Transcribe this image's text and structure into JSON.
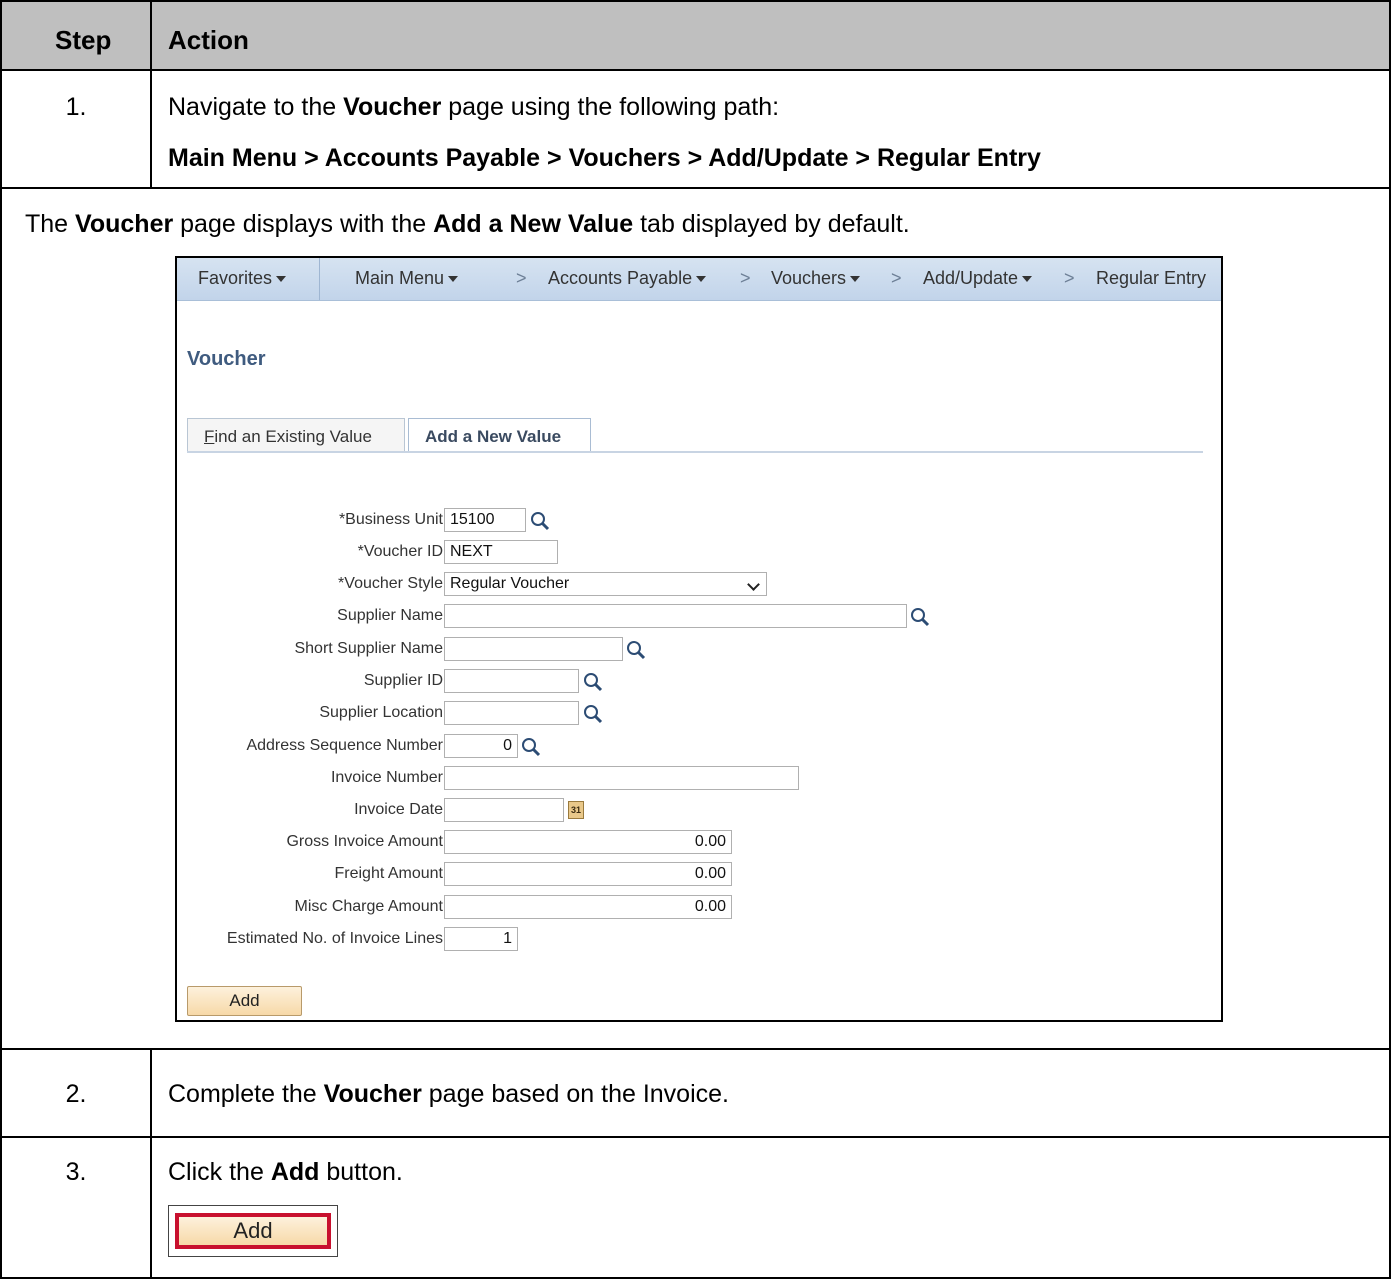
{
  "table": {
    "header": {
      "step": "Step",
      "action": "Action"
    },
    "step1": {
      "number": "1.",
      "text_pre": "Navigate to the ",
      "text_bold": "Voucher",
      "text_post": " page using the following path:",
      "path": "Main Menu > Accounts Payable > Vouchers > Add/Update > Regular Entry"
    },
    "note": {
      "pre": "The ",
      "b1": "Voucher",
      "mid": " page displays with the ",
      "b2": "Add a New Value",
      "post": " tab displayed by default."
    },
    "step2": {
      "number": "2.",
      "pre": "Complete the ",
      "bold": "Voucher",
      "post": " page based on the Invoice."
    },
    "step3": {
      "number": "3.",
      "pre": "Click the ",
      "bold": "Add",
      "post": " button.",
      "button_label": "Add"
    }
  },
  "screenshot": {
    "nav": {
      "favorites": "Favorites",
      "main_menu": "Main Menu",
      "accounts_payable": "Accounts Payable",
      "vouchers": "Vouchers",
      "add_update": "Add/Update",
      "regular_entry": "Regular Entry",
      "chevron": ">"
    },
    "page_title": "Voucher",
    "tabs": {
      "find_existing": "Find an Existing Value",
      "add_new": "Add a New Value"
    },
    "labels": {
      "business_unit": "*Business Unit",
      "voucher_id": "*Voucher ID",
      "voucher_style": "*Voucher Style",
      "supplier_name": "Supplier Name",
      "short_supplier_name": "Short Supplier Name",
      "supplier_id": "Supplier ID",
      "supplier_location": "Supplier Location",
      "address_sequence": "Address Sequence Number",
      "invoice_number": "Invoice Number",
      "invoice_date": "Invoice Date",
      "gross_invoice_amount": "Gross Invoice Amount",
      "freight_amount": "Freight Amount",
      "misc_charge_amount": "Misc Charge Amount",
      "estimated_lines": "Estimated No. of Invoice Lines"
    },
    "values": {
      "business_unit": "15100",
      "voucher_id": "NEXT",
      "voucher_style": "Regular Voucher",
      "supplier_name": "",
      "short_supplier_name": "",
      "supplier_id": "",
      "supplier_location": "",
      "address_sequence": "0",
      "invoice_number": "",
      "invoice_date": "",
      "gross_invoice_amount": "0.00",
      "freight_amount": "0.00",
      "misc_charge_amount": "0.00",
      "estimated_lines": "1"
    },
    "calendar_glyph": "31",
    "add_button": "Add"
  },
  "colors": {
    "header_bg": "#bfbfbf",
    "nav_bg": "#c9d9ec",
    "title": "#3f5b7f",
    "button": "#f7d9a8",
    "highlight": "#c8102e"
  },
  "icons": [
    "magnifier-icon",
    "calendar-icon",
    "caret-down-icon"
  ]
}
